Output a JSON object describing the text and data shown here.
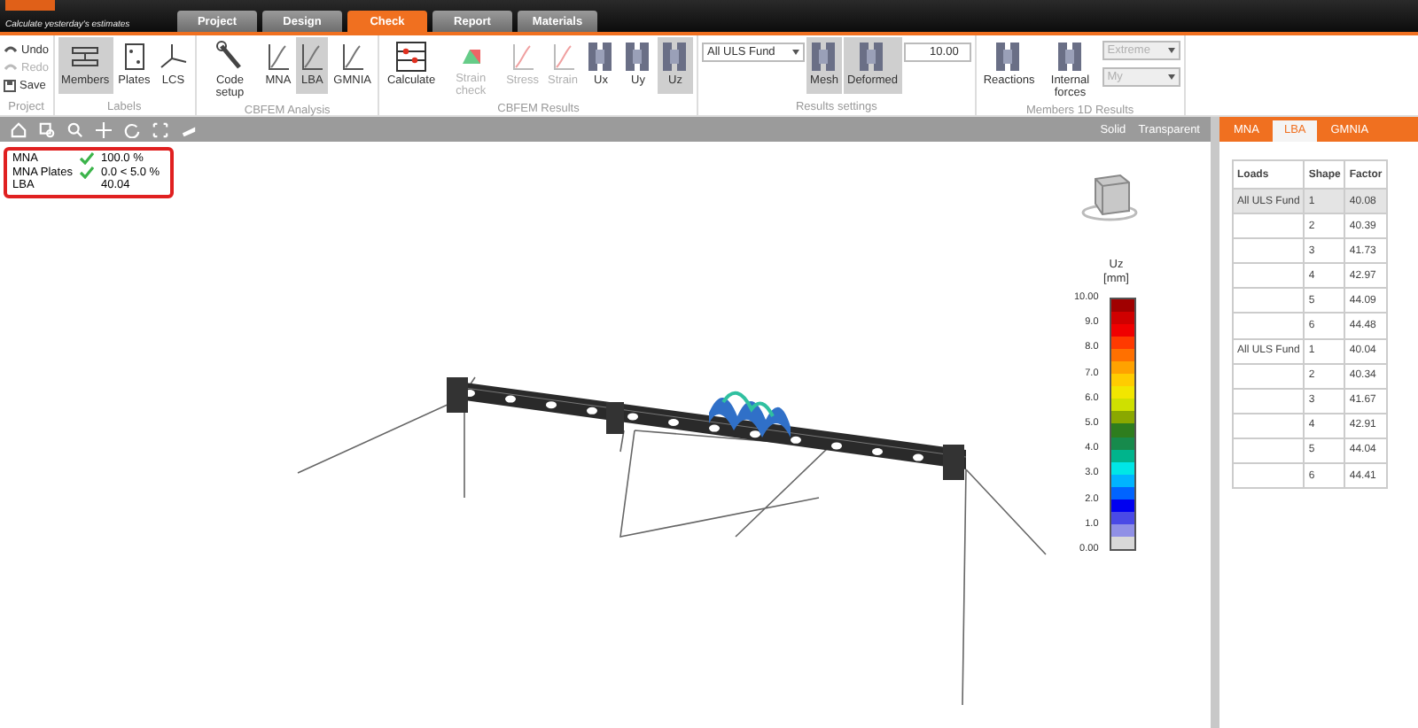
{
  "header": {
    "tagline": "Calculate yesterday's estimates"
  },
  "tabs": [
    {
      "label": "Project",
      "selected": false
    },
    {
      "label": "Design",
      "selected": false
    },
    {
      "label": "Check",
      "selected": true
    },
    {
      "label": "Report",
      "selected": false
    },
    {
      "label": "Materials",
      "selected": false
    }
  ],
  "ribbon": {
    "groups": [
      {
        "label": "Project",
        "items": [
          {
            "kind": "small",
            "label": "Undo",
            "disabled": false
          },
          {
            "kind": "small",
            "label": "Redo",
            "disabled": true
          },
          {
            "kind": "small",
            "label": "Save",
            "disabled": false
          }
        ]
      },
      {
        "label": "Labels",
        "items": [
          {
            "kind": "large",
            "label": "Members",
            "selected": true,
            "disabled": false
          },
          {
            "kind": "large",
            "label": "Plates",
            "selected": false,
            "disabled": false
          },
          {
            "kind": "large",
            "label": "LCS",
            "selected": false,
            "disabled": false
          }
        ]
      },
      {
        "label": "CBFEM Analysis",
        "items": [
          {
            "kind": "large",
            "label": "Code setup",
            "selected": false,
            "disabled": false
          },
          {
            "kind": "large",
            "label": "MNA",
            "selected": false,
            "disabled": false
          },
          {
            "kind": "large",
            "label": "LBA",
            "selected": true,
            "disabled": false
          },
          {
            "kind": "large",
            "label": "GMNIA",
            "selected": false,
            "disabled": false
          }
        ]
      },
      {
        "label": "CBFEM Results",
        "items": [
          {
            "kind": "large",
            "label": "Calculate",
            "selected": false,
            "disabled": false
          },
          {
            "kind": "large",
            "label": "Strain check",
            "selected": false,
            "disabled": true
          },
          {
            "kind": "large",
            "label": "Stress",
            "selected": false,
            "disabled": true
          },
          {
            "kind": "large",
            "label": "Strain",
            "selected": false,
            "disabled": true
          },
          {
            "kind": "large",
            "label": "Ux",
            "selected": false,
            "disabled": false
          },
          {
            "kind": "large",
            "label": "Uy",
            "selected": false,
            "disabled": false
          },
          {
            "kind": "large",
            "label": "Uz",
            "selected": true,
            "disabled": false
          }
        ]
      },
      {
        "label": "Results settings",
        "items": [
          {
            "kind": "dropdown",
            "value": "All ULS Fund",
            "disabled": false
          },
          {
            "kind": "large",
            "label": "Mesh",
            "selected": true,
            "disabled": false
          },
          {
            "kind": "large",
            "label": "Deformed",
            "selected": true,
            "disabled": false
          },
          {
            "kind": "spinner",
            "value": "10.00",
            "disabled": false
          }
        ]
      },
      {
        "label": "Members 1D Results",
        "items": [
          {
            "kind": "large",
            "label": "Reactions",
            "selected": false,
            "disabled": false
          },
          {
            "kind": "large",
            "label": "Internal forces",
            "selected": false,
            "disabled": false
          },
          {
            "kind": "dropdowns",
            "values": [
              "Extreme",
              "My"
            ],
            "disabled": true
          }
        ]
      }
    ]
  },
  "view_toolbar": {
    "modes": [
      "Solid",
      "Transparent"
    ]
  },
  "summary": [
    {
      "label": "MNA",
      "passed": true,
      "value": "100.0 %"
    },
    {
      "label": "MNA Plates",
      "passed": true,
      "value": "0.0 < 5.0 %"
    },
    {
      "label": "LBA",
      "passed": false,
      "value": "40.04"
    }
  ],
  "legend": {
    "title": "Uz",
    "unit": "[mm]",
    "ticks": [
      "10.00",
      "9.0",
      "8.0",
      "7.0",
      "6.0",
      "5.0",
      "4.0",
      "3.0",
      "2.0",
      "1.0",
      "0.00"
    ],
    "bands": [
      {
        "color": "#a00000"
      },
      {
        "color": "#d00000"
      },
      {
        "color": "#f00000"
      },
      {
        "color": "#ff3a00"
      },
      {
        "color": "#ff7000"
      },
      {
        "color": "#ffa200"
      },
      {
        "color": "#ffcc00"
      },
      {
        "color": "#f2e600"
      },
      {
        "color": "#cfe000"
      },
      {
        "color": "#8aa800"
      },
      {
        "color": "#2e7d1e"
      },
      {
        "color": "#178a4c"
      },
      {
        "color": "#00b48c"
      },
      {
        "color": "#00e6e6"
      },
      {
        "color": "#00b4ff"
      },
      {
        "color": "#0064ff"
      },
      {
        "color": "#0000f0"
      },
      {
        "color": "#4a4ae6"
      },
      {
        "color": "#9090e6"
      },
      {
        "color": "#d8d8d8"
      }
    ]
  },
  "panel": {
    "tabs": [
      {
        "label": "MNA",
        "selected": false
      },
      {
        "label": "LBA",
        "selected": true
      },
      {
        "label": "GMNIA",
        "selected": false
      }
    ],
    "columns": [
      "Loads",
      "Shape",
      "Factor"
    ],
    "rows": [
      {
        "loads": "All ULS Fund",
        "shape": "1",
        "factor": "40.08",
        "selected": true
      },
      {
        "shape": "2",
        "factor": "40.39",
        "selected": false
      },
      {
        "shape": "3",
        "factor": "41.73",
        "selected": false
      },
      {
        "shape": "4",
        "factor": "42.97",
        "selected": false
      },
      {
        "shape": "5",
        "factor": "44.09",
        "selected": false
      },
      {
        "shape": "6",
        "factor": "44.48",
        "selected": false
      },
      {
        "loads": "All ULS Fund",
        "shape": "1",
        "factor": "40.04",
        "selected": false
      },
      {
        "shape": "2",
        "factor": "40.34",
        "selected": false
      },
      {
        "shape": "3",
        "factor": "41.67",
        "selected": false
      },
      {
        "shape": "4",
        "factor": "42.91",
        "selected": false
      },
      {
        "shape": "5",
        "factor": "44.04",
        "selected": false
      },
      {
        "shape": "6",
        "factor": "44.41",
        "selected": false
      }
    ]
  }
}
